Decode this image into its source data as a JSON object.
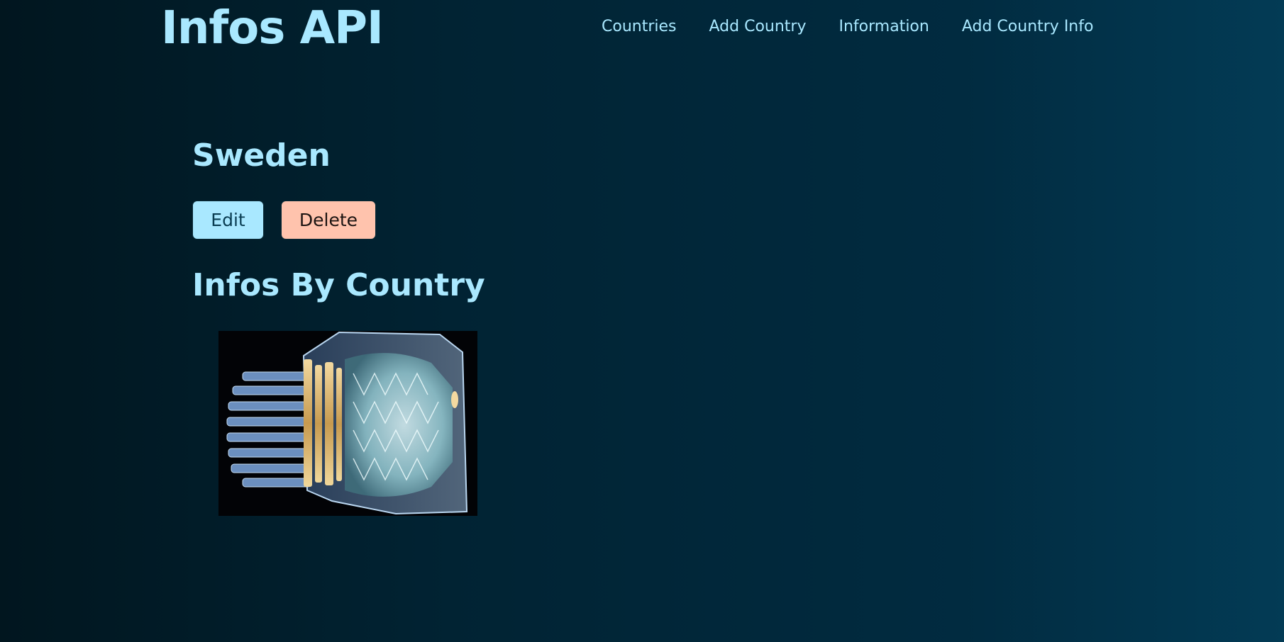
{
  "header": {
    "title": "Infos API",
    "nav": [
      "Countries",
      "Add Country",
      "Information",
      "Add Country Info"
    ]
  },
  "country": {
    "name": "Sweden",
    "edit_label": "Edit",
    "delete_label": "Delete"
  },
  "infos_section": {
    "title": "Infos By Country",
    "image": "jet-engine-cutaway-image"
  },
  "colors": {
    "accent": "#a9e8ff",
    "danger": "#ffc3ad",
    "background_dark": "#01161f",
    "background_light": "#033b55"
  }
}
